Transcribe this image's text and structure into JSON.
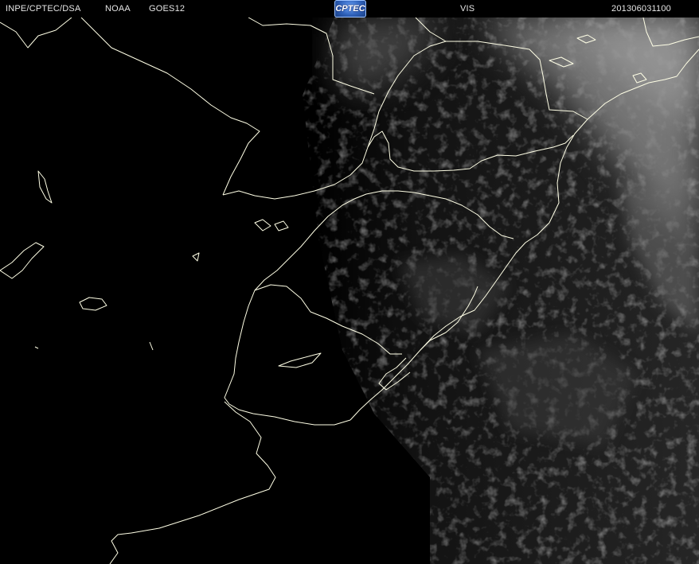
{
  "header": {
    "agency": "INPE/CPTEC/DSA",
    "provider": "NOAA",
    "satellite": "GOES12",
    "logo_text": "CPTEC",
    "channel": "VIS",
    "timestamp": "201306031100"
  },
  "colors": {
    "background": "#000000",
    "header_text": "#e6e6e6",
    "coastline": "#ffffe6",
    "cloud_bright": "#8a8a8a",
    "cloud_dim": "#2a2a2a"
  }
}
